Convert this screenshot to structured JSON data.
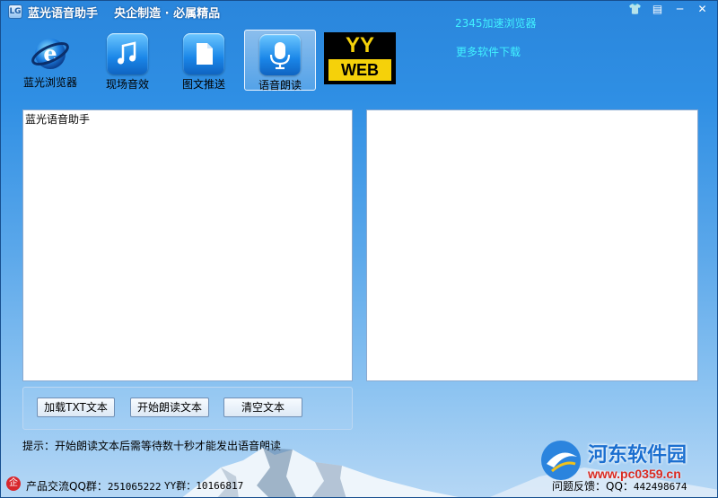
{
  "window": {
    "title": "蓝光语音助手    央企制造 · 必属精品",
    "icon_text": "LG",
    "controls": {
      "skin": "👕",
      "menu": "▤",
      "minimize": "─",
      "close": "✕"
    }
  },
  "toolbar": {
    "items": [
      {
        "label": "蓝光浏览器",
        "icon": "ie-browser-icon"
      },
      {
        "label": "现场音效",
        "icon": "music-note-icon"
      },
      {
        "label": "图文推送",
        "icon": "document-icon"
      },
      {
        "label": "语音朗读",
        "icon": "microphone-icon",
        "active": true
      }
    ],
    "yyweb": {
      "top": "YY",
      "bottom": "WEB"
    }
  },
  "links": {
    "browser": "2345加速浏览器",
    "more_software": "更多软件下载"
  },
  "editor": {
    "text": "蓝光语音助手"
  },
  "buttons": {
    "load_txt": "加载TXT文本",
    "start_read": "开始朗读文本",
    "clear_text": "清空文本"
  },
  "tip": "提示：开始朗读文本后需等待数十秒才能发出语音朗读",
  "status": {
    "qq_group_label": "产品交流QQ群：",
    "qq_group": "251065222",
    "yy_label": "YY群：",
    "yy_group": "10166817",
    "feedback_label": "问题反馈：QQ：",
    "feedback_qq": "442498674"
  },
  "watermark": {
    "name": "河东软件园",
    "url": "www.pc0359.cn"
  },
  "colors": {
    "link": "#41f2ff",
    "accent": "#1f6fc4",
    "yyweb_yellow": "#f5d10a"
  }
}
